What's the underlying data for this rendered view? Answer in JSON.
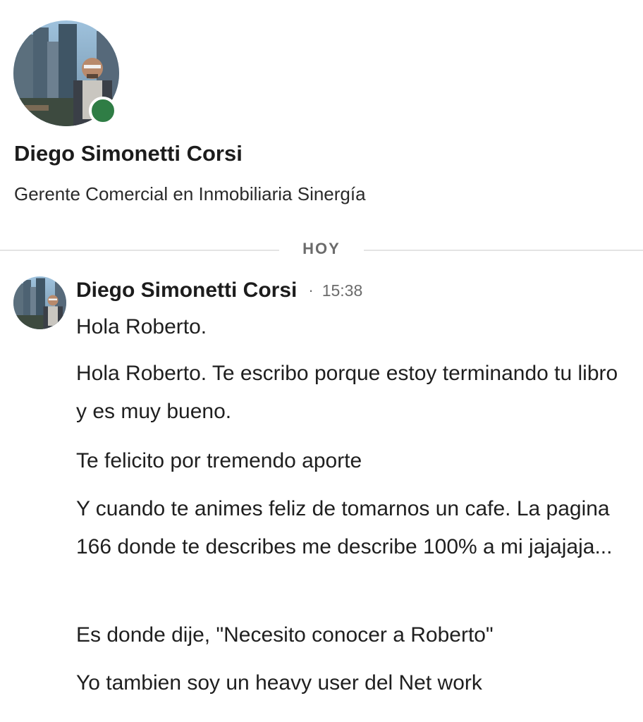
{
  "profile": {
    "name": "Diego Simonetti Corsi",
    "headline": "Gerente Comercial en Inmobiliaria Sinergía",
    "online_status_color": "#2f7d45"
  },
  "day_divider": {
    "label": "HOY"
  },
  "conversation": {
    "sender": "Diego Simonetti Corsi",
    "time": "15:38",
    "separator": "·",
    "messages": [
      "Hola Roberto.",
      "Hola Roberto. Te escribo porque estoy terminando tu libro y es muy bueno.",
      "Te felicito por tremendo aporte",
      "Y cuando te animes feliz de tomarnos un cafe. La pagina 166 donde te describes me describe 100% a mi jajajaja...",
      "Es donde dije, \"Necesito conocer a Roberto\"",
      "Yo tambien soy un heavy user del Net work"
    ]
  }
}
